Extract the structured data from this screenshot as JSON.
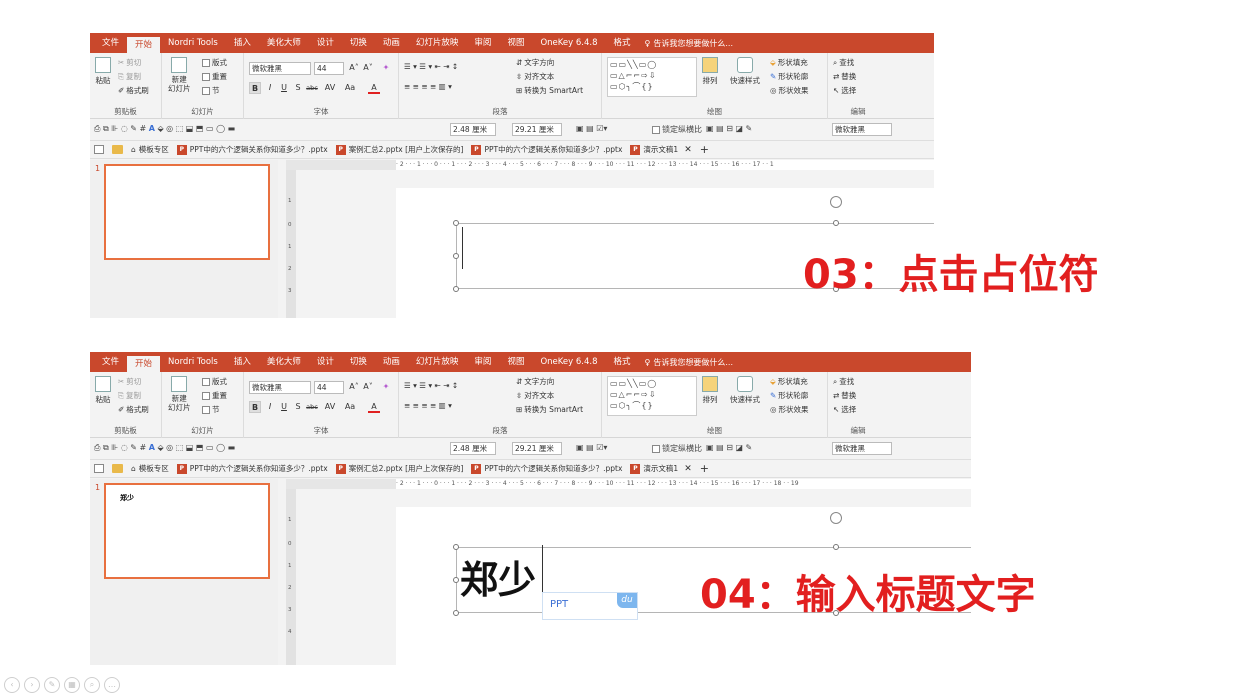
{
  "menu_tabs": [
    "文件",
    "开始",
    "Nordri Tools",
    "插入",
    "美化大师",
    "设计",
    "切换",
    "动画",
    "幻灯片放映",
    "审阅",
    "视图",
    "OneKey 6.4.8",
    "格式"
  ],
  "active_tab_index": 1,
  "format_tab_index": 12,
  "tell_me": "告诉我您想要做什么...",
  "ribbon": {
    "clipboard": {
      "cut": "剪切",
      "copy": "复制",
      "paste": "粘贴",
      "format_painter": "格式刷",
      "label": "剪贴板"
    },
    "slides": {
      "new_slide": "新建\n幻灯片",
      "layout": "版式",
      "reset": "重置",
      "section": "节",
      "label": "幻灯片"
    },
    "font": {
      "font_name": "微软雅黑",
      "font_size": "44",
      "bold": "B",
      "italic": "I",
      "underline": "U",
      "shadow": "S",
      "strike": "abc",
      "spacing": "AV",
      "case": "Aa",
      "color": "A",
      "grow": "A˄",
      "shrink": "A˅",
      "label": "字体"
    },
    "paragraph": {
      "text_direction": "文字方向",
      "align_text": "对齐文本",
      "smartart": "转换为 SmartArt",
      "label": "段落"
    },
    "drawing": {
      "arrange": "排列",
      "quick_styles": "快速样式",
      "shape_fill": "形状填充",
      "shape_outline": "形状轮廓",
      "shape_effects": "形状效果",
      "label": "绘图"
    },
    "editing": {
      "find": "查找",
      "replace": "替换",
      "select": "选择",
      "label": "编辑"
    }
  },
  "qat": {
    "height": "2.48 厘米",
    "width": "29.21 厘米",
    "lock_ratio": "锁定纵横比",
    "font": "微软雅黑"
  },
  "doc_tabs": [
    "模板专区",
    "PPT中的六个逻辑关系你知道多少？.pptx",
    "案例汇总2.pptx [用户上次保存的]",
    "PPT中的六个逻辑关系你知道多少？.pptx",
    "演示文稿1"
  ],
  "tab_close": "✕",
  "tab_add": "+",
  "ruler_text_1": "· 2 · · · 1 · · · 0 · · · 1 · · · 2 · · · 3 · · · 4 · · · 5 · · · 6 · · · 7 · · · 8 · · · 9 · · · 10 · · · 11 · · · 12 · · · 13 · · · 14 · · · 15 · · · 16 · · · 17 · · 1",
  "ruler_text_2": "· 2 · · · 1 · · · 0 · · · 1 · · · 2 · · · 3 · · · 4 · · · 5 · · · 6 · · · 7 · · · 8 · · · 9 · · · 10 · · · 11 · · · 12 · · · 13 · · · 14 · · · 15 · · · 16 · · · 17 · · · 18 · · 19",
  "shot1": {
    "slide_number": "1",
    "caption": "03：点击占位符"
  },
  "shot2": {
    "slide_number": "1",
    "thumb_text": "郑少",
    "title_text": "郑少",
    "ime_text": "PPT",
    "ime_logo": "du",
    "caption": "04：输入标题文字"
  },
  "bottom_controls": [
    "‹",
    "›",
    "✎",
    "▦",
    "⌕",
    "…"
  ]
}
